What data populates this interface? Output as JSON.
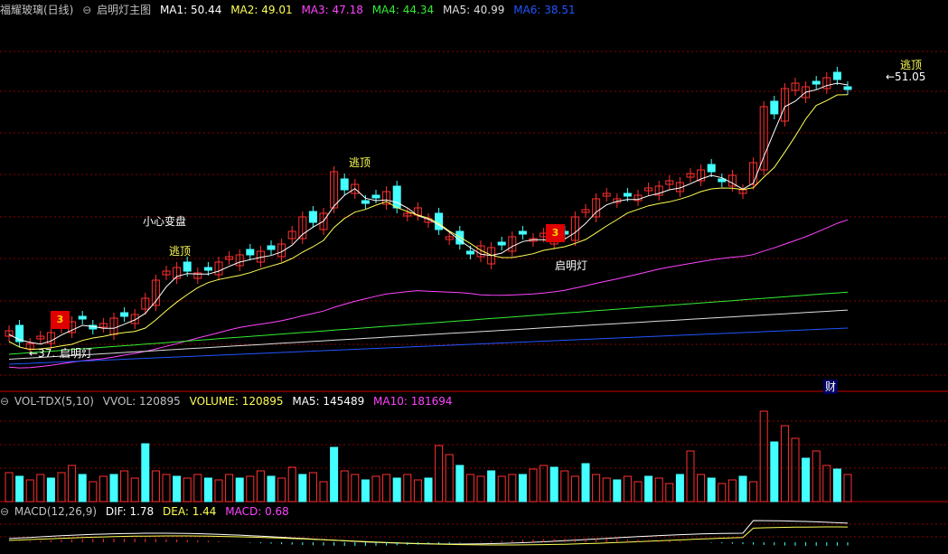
{
  "main_header": {
    "stock_name": "福耀玻璃(日线)",
    "indicator_name": "启明灯主图",
    "ma": [
      {
        "label": "MA1: 50.44",
        "color": "#ffffff"
      },
      {
        "label": "MA2: 49.01",
        "color": "#ffff55"
      },
      {
        "label": "MA3: 47.18",
        "color": "#ff44ff"
      },
      {
        "label": "MA4: 44.34",
        "color": "#33ee33"
      },
      {
        "label": "MA5: 40.99",
        "color": "#dddddd"
      },
      {
        "label": "MA6: 38.51",
        "color": "#2255ff"
      }
    ]
  },
  "vol_header": {
    "name": "VOL-TDX(5,10)",
    "vvol": "VVOL: 120895",
    "volume": "VOLUME: 120895",
    "ma5": "MA5: 145489",
    "ma10": "MA10: 181694"
  },
  "macd_header": {
    "name": "MACD(12,26,9)",
    "dif": "DIF: 1.78",
    "dea": "DEA: 1.44",
    "macd": "MACD: 0.68"
  },
  "annotations": {
    "low_price": "←37.",
    "low_lamp": "启明灯",
    "caution": "小心变盘",
    "escape_1": "逃顶",
    "escape_2": "逃顶",
    "escape_3": "逃顶",
    "mid_lamp": "启明灯",
    "high_price": "←51.05",
    "signal_1": "3",
    "signal_2": "3",
    "finance_badge": "财"
  },
  "colors": {
    "up": "#ff3030",
    "down": "#44ffff",
    "grid": "#8b0000",
    "separator": "#cc0000"
  }
}
